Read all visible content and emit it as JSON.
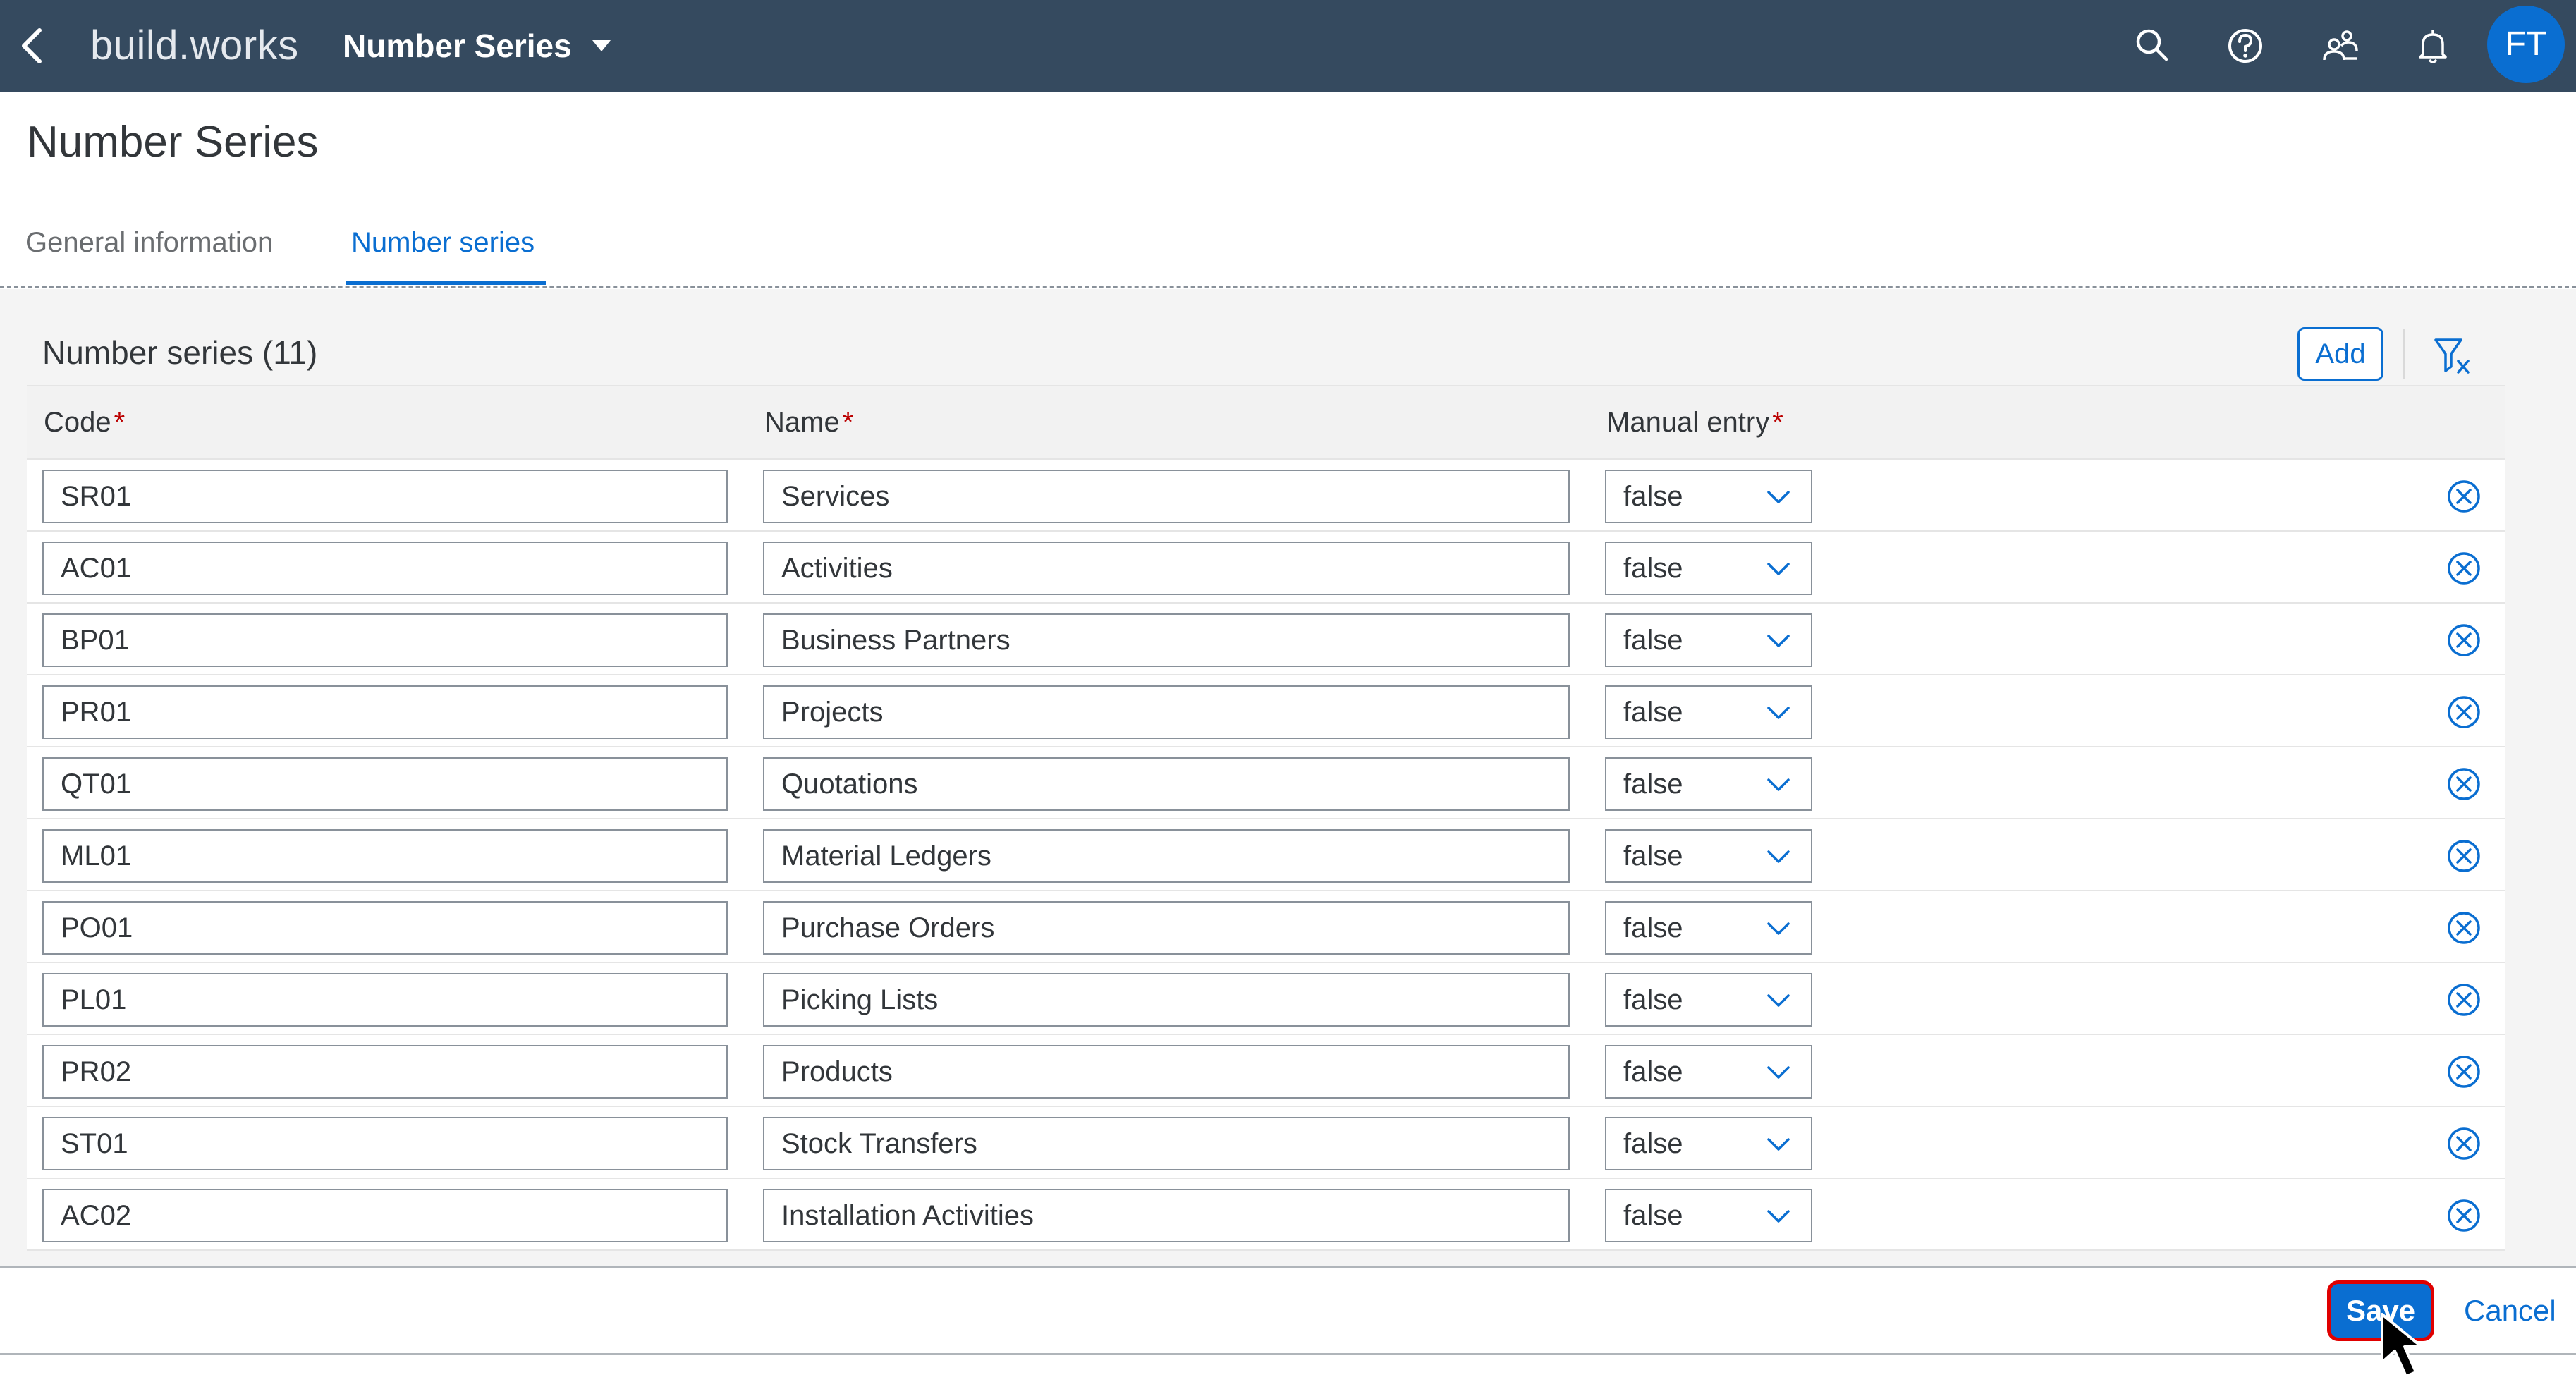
{
  "shell": {
    "logo_part1": "build",
    "logo_dot": ".",
    "logo_part2": "works",
    "app_title": "Number Series",
    "avatar_initials": "FT",
    "icons": [
      "back-icon",
      "search-icon",
      "help-icon",
      "user-group-icon",
      "notification-bell-icon"
    ]
  },
  "page": {
    "title": "Number Series",
    "tabs": [
      {
        "label": "General information",
        "selected": false
      },
      {
        "label": "Number series",
        "selected": true
      }
    ]
  },
  "table": {
    "title": "Number series (11)",
    "add_label": "Add",
    "columns": [
      {
        "label": "Code",
        "required_mark": "*"
      },
      {
        "label": "Name",
        "required_mark": "*"
      },
      {
        "label": "Manual entry",
        "required_mark": "*"
      }
    ],
    "rows": [
      {
        "code": "SR01",
        "name": "Services",
        "manual": "false"
      },
      {
        "code": "AC01",
        "name": "Activities",
        "manual": "false"
      },
      {
        "code": "BP01",
        "name": "Business Partners",
        "manual": "false"
      },
      {
        "code": "PR01",
        "name": "Projects",
        "manual": "false"
      },
      {
        "code": "QT01",
        "name": "Quotations",
        "manual": "false"
      },
      {
        "code": "ML01",
        "name": "Material Ledgers",
        "manual": "false"
      },
      {
        "code": "PO01",
        "name": "Purchase Orders",
        "manual": "false"
      },
      {
        "code": "PL01",
        "name": "Picking Lists",
        "manual": "false"
      },
      {
        "code": "PR02",
        "name": "Products",
        "manual": "false"
      },
      {
        "code": "ST01",
        "name": "Stock Transfers",
        "manual": "false"
      },
      {
        "code": "AC02",
        "name": "Installation Activities",
        "manual": "false"
      }
    ]
  },
  "footer": {
    "save_label": "Save",
    "cancel_label": "Cancel"
  },
  "colors": {
    "shell_bg": "#354a5f",
    "accent": "#0a6ed1",
    "required": "#bb0000",
    "highlight": "#e00000"
  }
}
